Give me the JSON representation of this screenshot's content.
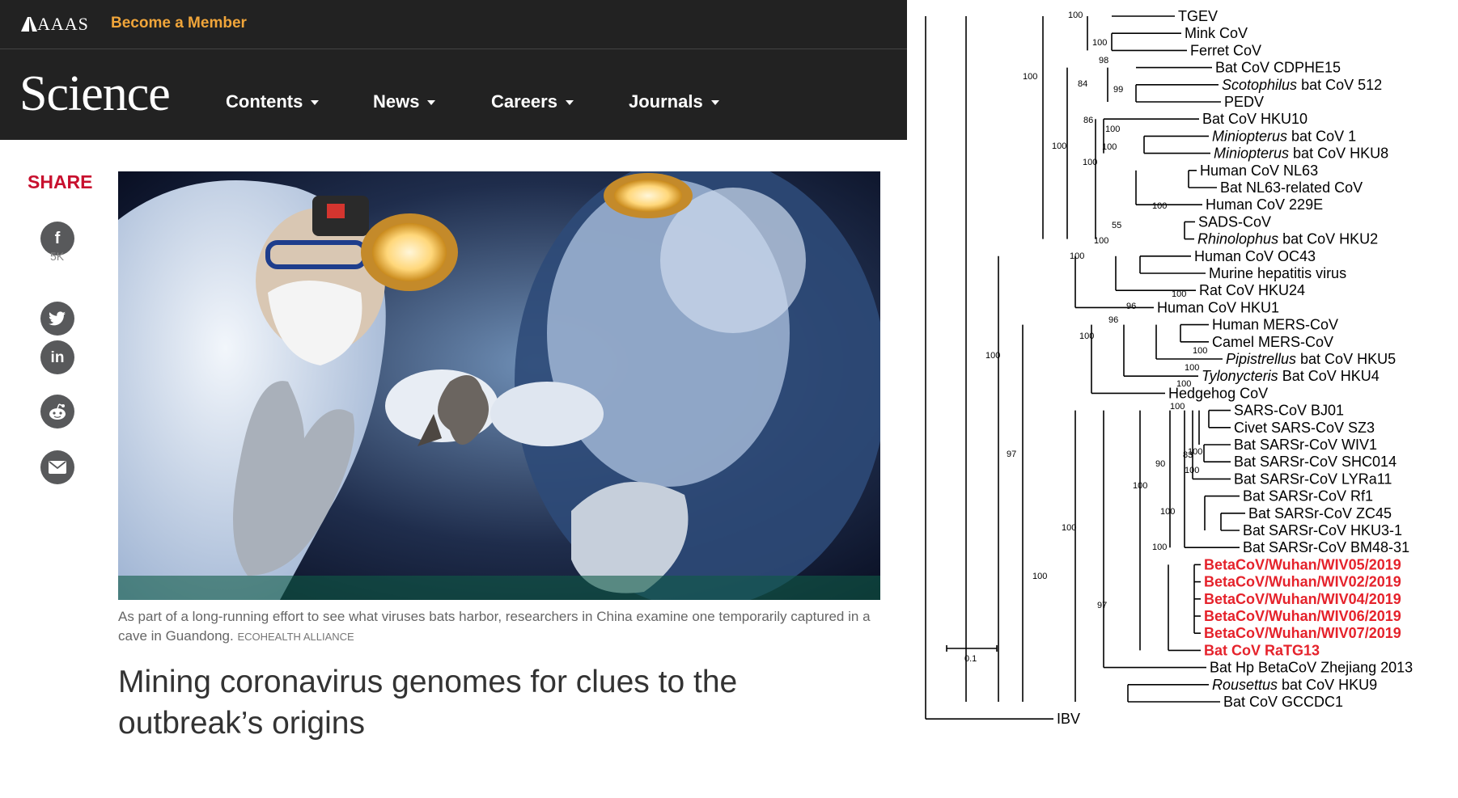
{
  "header": {
    "brand": "AAAS",
    "member_link": "Become a Member",
    "logo": "Science",
    "nav": [
      {
        "label": "Contents"
      },
      {
        "label": "News"
      },
      {
        "label": "Careers"
      },
      {
        "label": "Journals"
      }
    ]
  },
  "share": {
    "label": "SHARE",
    "count": "5K",
    "icons": [
      "facebook-icon",
      "twitter-icon",
      "linkedin-icon",
      "reddit-icon",
      "email-icon"
    ]
  },
  "article": {
    "caption": "As part of a long-running effort to see what viruses bats harbor, researchers in China examine one temporarily captured in a cave in Guandong.",
    "credit": "ECOHEALTH ALLIANCE",
    "headline": "Mining coronavirus genomes for clues to the outbreak’s origins"
  },
  "tree": {
    "scale_label": "0.1",
    "leaves": [
      {
        "label": "TGEV"
      },
      {
        "label": "Mink CoV"
      },
      {
        "label": "Ferret CoV"
      },
      {
        "label": "Bat CoV CDPHE15"
      },
      {
        "italic": "Scotophilus",
        "label": " bat CoV 512"
      },
      {
        "label": "PEDV"
      },
      {
        "label": "Bat CoV HKU10"
      },
      {
        "italic": "Miniopterus",
        "label": " bat CoV 1"
      },
      {
        "italic": "Miniopterus",
        "label": " bat CoV HKU8"
      },
      {
        "label": "Human CoV NL63"
      },
      {
        "label": "Bat NL63-related CoV"
      },
      {
        "label": "Human CoV 229E"
      },
      {
        "label": "SADS-CoV"
      },
      {
        "italic": "Rhinolophus",
        "label": " bat CoV HKU2"
      },
      {
        "label": "Human CoV OC43"
      },
      {
        "label": "Murine hepatitis virus"
      },
      {
        "label": "Rat CoV HKU24"
      },
      {
        "label": "Human CoV HKU1"
      },
      {
        "label": "Human MERS-CoV"
      },
      {
        "label": "Camel MERS-CoV"
      },
      {
        "italic": "Pipistrellus",
        "label": " bat CoV HKU5"
      },
      {
        "italic": "Tylonycteris",
        "label": " Bat CoV HKU4"
      },
      {
        "label": "Hedgehog CoV"
      },
      {
        "label": "SARS-CoV BJ01"
      },
      {
        "label": "Civet SARS-CoV SZ3"
      },
      {
        "label": "Bat SARSr-CoV WIV1"
      },
      {
        "label": "Bat SARSr-CoV SHC014"
      },
      {
        "label": "Bat SARSr-CoV LYRa11"
      },
      {
        "label": "Bat SARSr-CoV Rf1"
      },
      {
        "label": "Bat SARSr-CoV ZC45"
      },
      {
        "label": "Bat SARSr-CoV HKU3-1"
      },
      {
        "label": "Bat SARSr-CoV BM48-31"
      },
      {
        "label": "BetaCoV/Wuhan/WIV05/2019",
        "highlight": true
      },
      {
        "label": "BetaCoV/Wuhan/WIV02/2019",
        "highlight": true
      },
      {
        "label": "BetaCoV/Wuhan/WIV04/2019",
        "highlight": true
      },
      {
        "label": "BetaCoV/Wuhan/WIV06/2019",
        "highlight": true
      },
      {
        "label": "BetaCoV/Wuhan/WIV07/2019",
        "highlight": true
      },
      {
        "label": "Bat CoV RaTG13",
        "highlight": true
      },
      {
        "label": "Bat Hp BetaCoV Zhejiang 2013"
      },
      {
        "italic": "Rousettus",
        "label": " bat CoV HKU9"
      },
      {
        "label": "Bat CoV GCCDC1"
      },
      {
        "label": "IBV"
      }
    ],
    "bootstrap": [
      "100",
      "100",
      "100",
      "98",
      "99",
      "84",
      "86",
      "100",
      "100",
      "100",
      "100",
      "100",
      "55",
      "100",
      "100",
      "100",
      "96",
      "96",
      "100",
      "100",
      "100",
      "100",
      "100",
      "100",
      "90",
      "83",
      "100",
      "100",
      "100",
      "100",
      "100",
      "100",
      "97",
      "100",
      "97"
    ]
  },
  "colors": {
    "header_bg": "#222222",
    "member_link": "#f0a53a",
    "share_red": "#c8102e",
    "share_icon_bg": "#58595b",
    "highlight_red": "#e5222b"
  }
}
